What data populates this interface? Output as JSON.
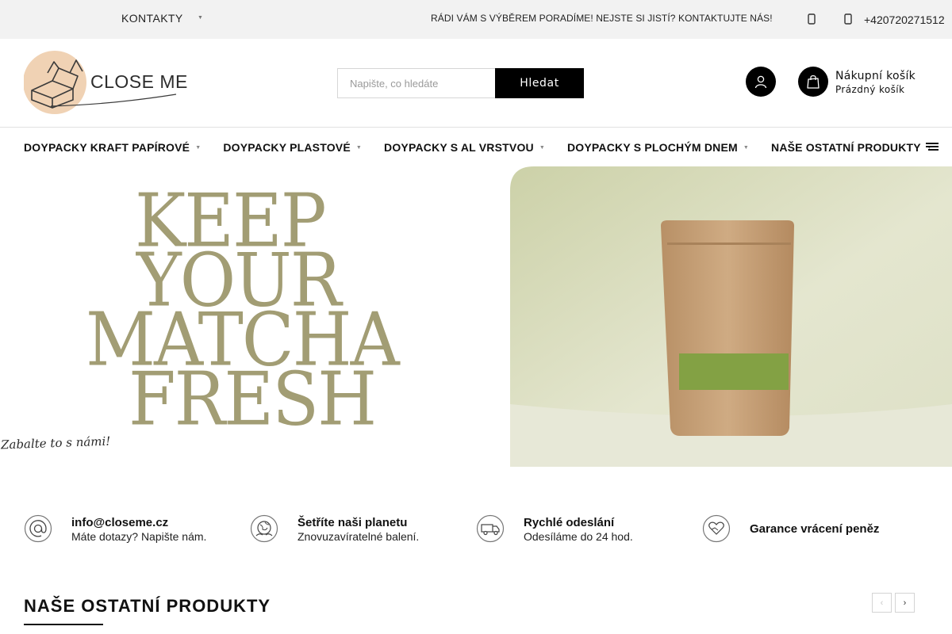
{
  "topbar": {
    "contacts_label": "KONTAKTY",
    "message": "RÁDI VÁM S VÝBĚREM PORADÍME! NEJSTE SI JISTÍ? KONTAKTUJTE NÁS!",
    "phone": "+420720271512"
  },
  "header": {
    "logo_text": "CLOSE ME",
    "search_placeholder": "Napište, co hledáte",
    "search_button": "Hledat",
    "cart_title": "Nákupní košík",
    "cart_status": "Prázdný košík"
  },
  "nav": {
    "items": [
      {
        "label": "DOYPACKY KRAFT PAPÍROVÉ"
      },
      {
        "label": "DOYPACKY PLASTOVÉ"
      },
      {
        "label": "DOYPACKY S AL VRSTVOU"
      },
      {
        "label": "DOYPACKY S PLOCHÝM DNEM"
      },
      {
        "label": "NAŠE OSTATNÍ PRODUKTY"
      }
    ]
  },
  "banner": {
    "headline": [
      "KEEP",
      "YOUR",
      "MATCHA",
      "FRESH"
    ],
    "tagline": "Zabalte to s námi!",
    "colors": {
      "headline": "#a29d74",
      "photo_bg": "#dfe2c6",
      "pouch": "#c8a680",
      "matcha": "#8aa84a"
    }
  },
  "benefits": [
    {
      "icon": "at-sign-icon",
      "title": "info@closeme.cz",
      "text": "Máte dotazy? Napište nám."
    },
    {
      "icon": "planet-icon",
      "title": "Šetříte naši planetu",
      "text": "Znovuzavíratelné balení."
    },
    {
      "icon": "truck-icon",
      "title": "Rychlé odeslání",
      "text": "Odesíláme do 24 hod."
    },
    {
      "icon": "heart-hands-icon",
      "title": "Garance vrácení peněz",
      "text": ""
    }
  ],
  "section": {
    "title": "NAŠE OSTATNÍ PRODUKTY",
    "prev": "‹",
    "next": "›"
  }
}
